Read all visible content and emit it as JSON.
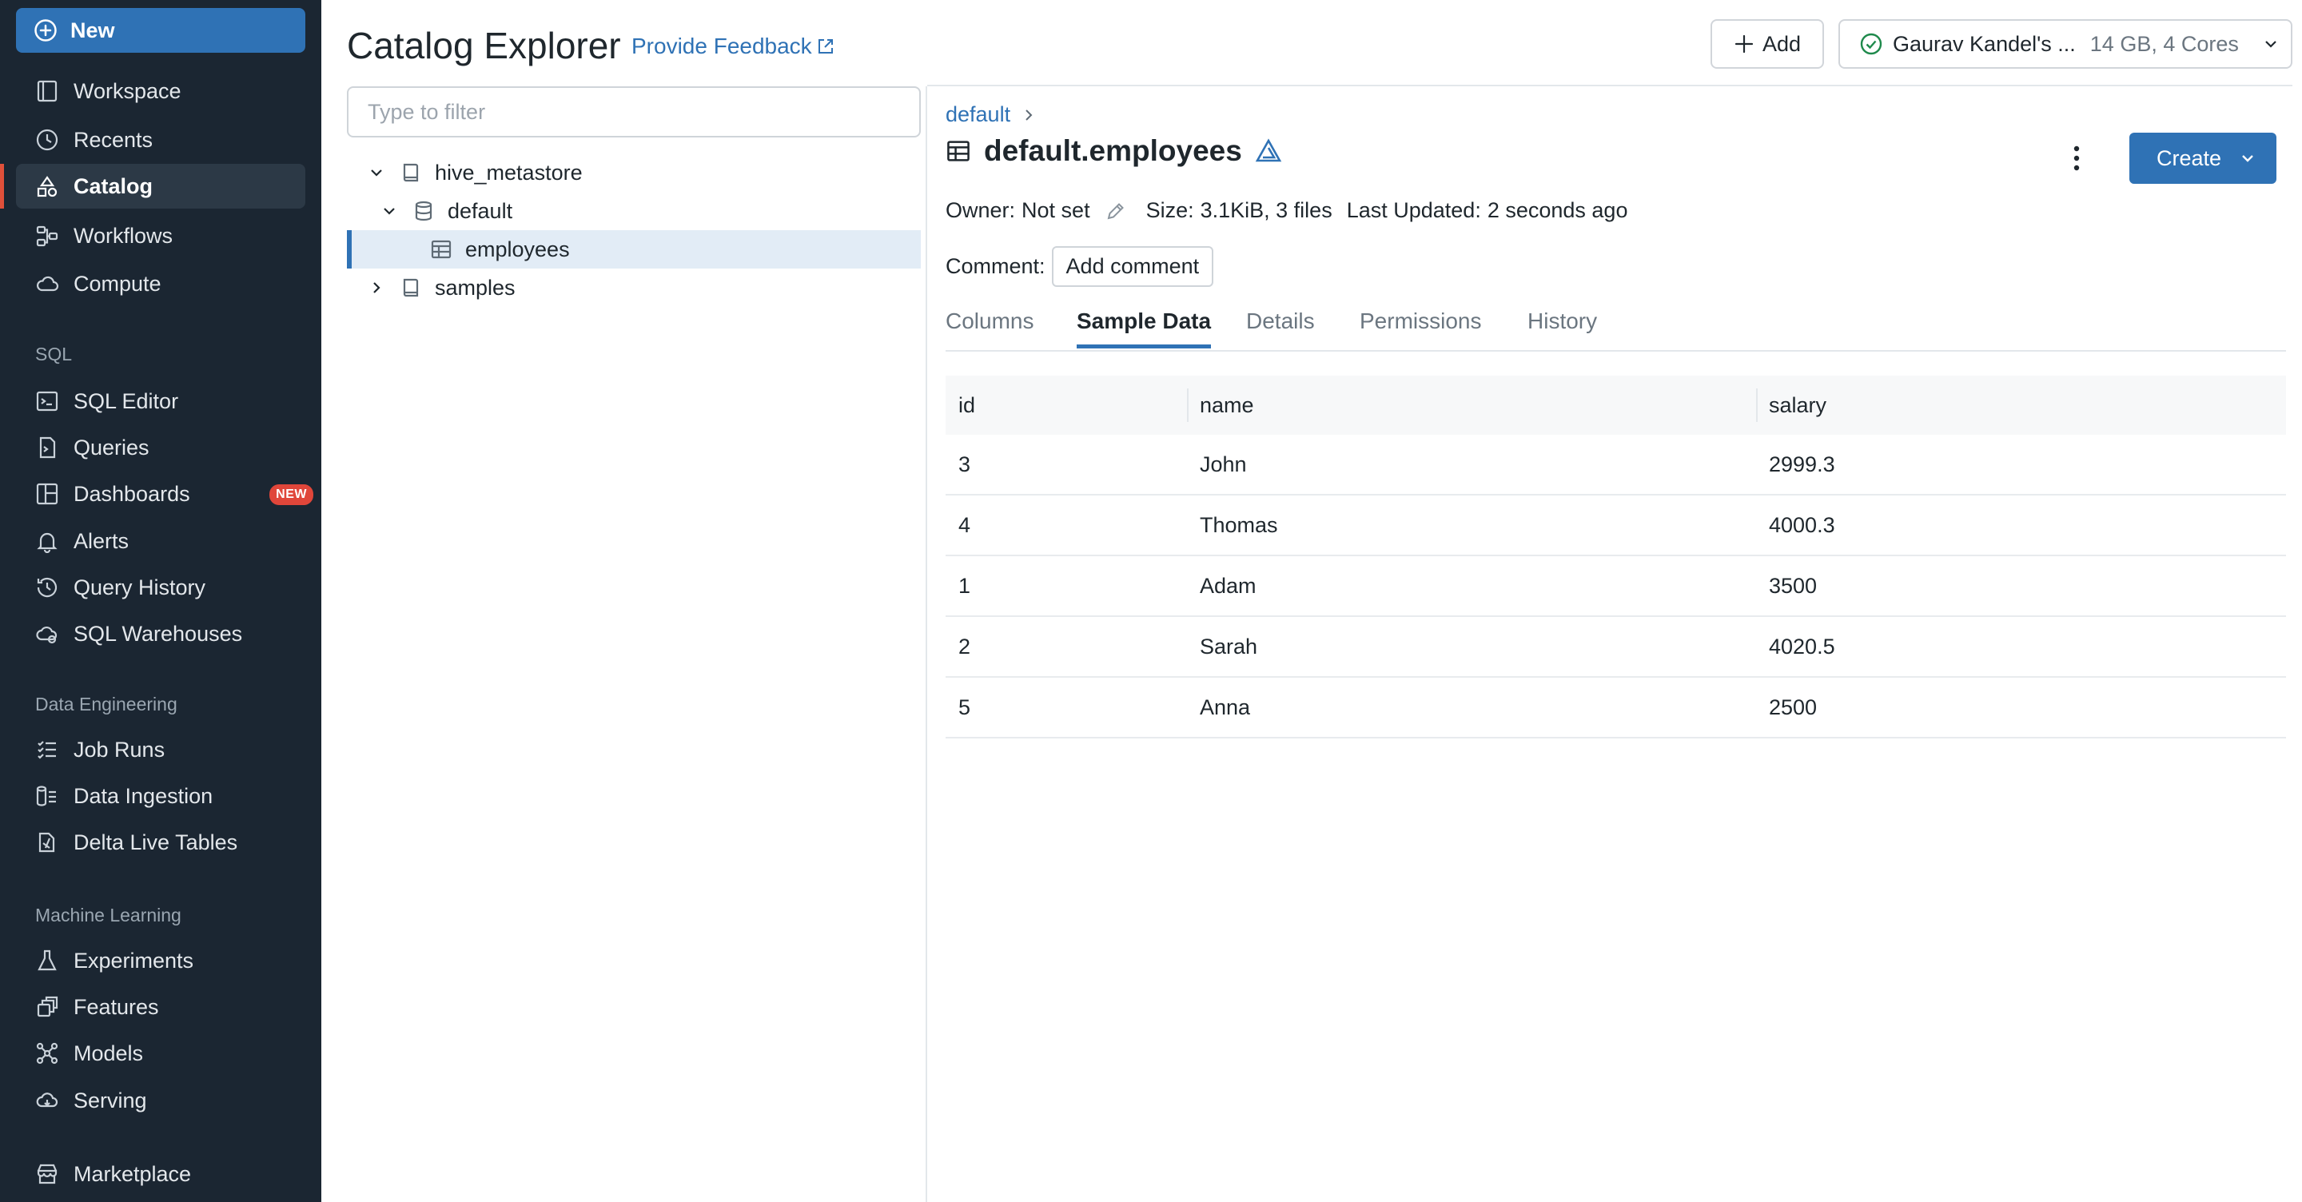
{
  "sidebar": {
    "new_label": "New",
    "main_items": [
      {
        "label": "Workspace",
        "icon": "workspace-icon"
      },
      {
        "label": "Recents",
        "icon": "clock-icon"
      },
      {
        "label": "Catalog",
        "icon": "catalog-icon",
        "active": true
      },
      {
        "label": "Workflows",
        "icon": "workflows-icon"
      },
      {
        "label": "Compute",
        "icon": "cloud-icon"
      }
    ],
    "sql_label": "SQL",
    "sql_items": [
      {
        "label": "SQL Editor",
        "icon": "sql-editor-icon"
      },
      {
        "label": "Queries",
        "icon": "queries-icon"
      },
      {
        "label": "Dashboards",
        "icon": "dashboards-icon",
        "badge": "NEW"
      },
      {
        "label": "Alerts",
        "icon": "bell-icon"
      },
      {
        "label": "Query History",
        "icon": "history-icon"
      },
      {
        "label": "SQL Warehouses",
        "icon": "warehouse-icon"
      }
    ],
    "de_label": "Data Engineering",
    "de_items": [
      {
        "label": "Job Runs",
        "icon": "job-runs-icon"
      },
      {
        "label": "Data Ingestion",
        "icon": "ingestion-icon"
      },
      {
        "label": "Delta Live Tables",
        "icon": "delta-icon"
      }
    ],
    "ml_label": "Machine Learning",
    "ml_items": [
      {
        "label": "Experiments",
        "icon": "flask-icon"
      },
      {
        "label": "Features",
        "icon": "features-icon"
      },
      {
        "label": "Models",
        "icon": "models-icon"
      },
      {
        "label": "Serving",
        "icon": "serving-icon"
      }
    ],
    "marketplace_label": "Marketplace"
  },
  "header": {
    "title": "Catalog Explorer",
    "feedback_label": "Provide Feedback",
    "add_label": "Add",
    "cluster_name": "Gaurav Kandel's ...",
    "cluster_meta": "14 GB, 4 Cores"
  },
  "tree": {
    "filter_placeholder": "Type to filter",
    "items": [
      {
        "label": "hive_metastore",
        "level": 0,
        "expanded": true,
        "icon": "catalog-book-icon"
      },
      {
        "label": "default",
        "level": 1,
        "expanded": true,
        "icon": "database-icon"
      },
      {
        "label": "employees",
        "level": 2,
        "selected": true,
        "icon": "table-icon"
      },
      {
        "label": "samples",
        "level": 0,
        "expanded": false,
        "icon": "catalog-book-icon"
      }
    ]
  },
  "detail": {
    "breadcrumb": "default",
    "title": "default.employees",
    "owner_label": "Owner:",
    "owner_value": "Not set",
    "size_label": "Size:",
    "size_value": "3.1KiB, 3 files",
    "updated_label": "Last Updated:",
    "updated_value": "2 seconds ago",
    "comment_label": "Comment:",
    "add_comment_label": "Add comment",
    "create_label": "Create",
    "tabs": [
      "Columns",
      "Sample Data",
      "Details",
      "Permissions",
      "History"
    ],
    "active_tab": "Sample Data"
  },
  "sample_table": {
    "columns": [
      "id",
      "name",
      "salary"
    ],
    "rows": [
      [
        "3",
        "John",
        "2999.3"
      ],
      [
        "4",
        "Thomas",
        "4000.3"
      ],
      [
        "1",
        "Adam",
        "3500"
      ],
      [
        "2",
        "Sarah",
        "4020.5"
      ],
      [
        "5",
        "Anna",
        "2500"
      ]
    ]
  },
  "colors": {
    "sidebar_bg": "#1b2632",
    "accent_blue": "#2f72b5",
    "active_marker": "#e0503a",
    "badge_red": "#e0463a",
    "selection_bg": "#e2ecf6"
  }
}
